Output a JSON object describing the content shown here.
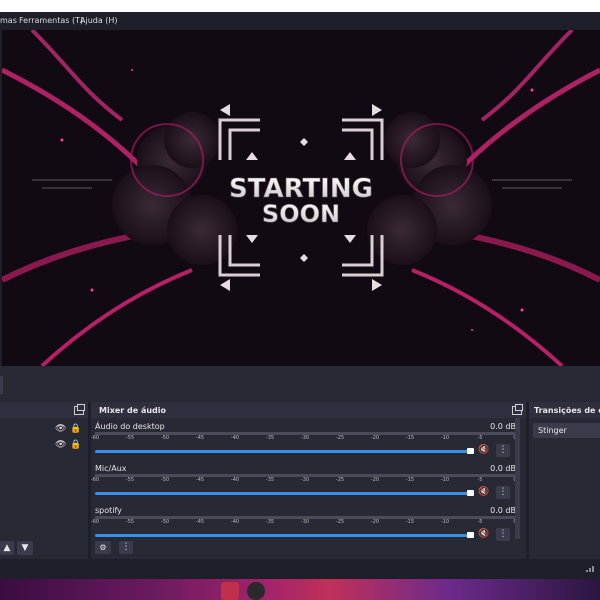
{
  "menu": {
    "items": [
      "mas",
      "Ferramentas (T)",
      "Ajuda (H)"
    ]
  },
  "preview": {
    "line1": "STARTING",
    "line2": "SOON",
    "accent": "#e0267a"
  },
  "scenes_panel": {
    "rows": [
      {
        "eye": "👁",
        "lock": "🔒"
      },
      {
        "eye": "👁",
        "lock": "🔒"
      }
    ],
    "up": "▲",
    "down": "▼"
  },
  "mixer": {
    "title": "Mixer de áudio",
    "ticks": [
      "-60",
      "-55",
      "-50",
      "-45",
      "-40",
      "-35",
      "-30",
      "-25",
      "-20",
      "-15",
      "-10",
      "-5",
      "0"
    ],
    "channels": [
      {
        "name": "Áudio do desktop",
        "db": "0.0 dB",
        "level": 1.0
      },
      {
        "name": "Mic/Aux",
        "db": "0.0 dB",
        "level": 1.0
      },
      {
        "name": "spotify",
        "db": "0.0 dB",
        "level": 1.0
      }
    ],
    "mute_icon": "🔇",
    "kebab": "⋮",
    "gear": "⚙"
  },
  "transitions": {
    "title": "Transições de cena",
    "selected": "Stinger"
  },
  "colors": {
    "bg": "#272935",
    "slider": "#3b8eea",
    "mute": "#e04050"
  }
}
